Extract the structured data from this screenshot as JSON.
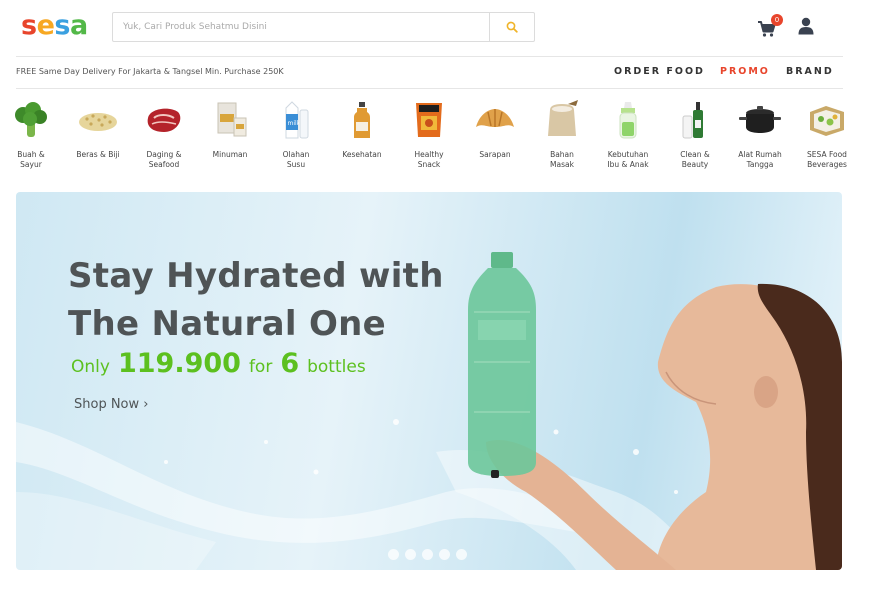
{
  "header": {
    "logo_letters": [
      "s",
      "e",
      "s",
      "a"
    ],
    "logo_colors": [
      "#e8452c",
      "#f7a823",
      "#3aa0e0",
      "#53b848"
    ],
    "search_placeholder": "Yuk, Cari Produk Sehatmu Disini",
    "cart_count": "0"
  },
  "subheader": {
    "delivery_text": "FREE Same Day Delivery For Jakarta & Tangsel Min. Purchase 250K",
    "nav": [
      "ORDER FOOD",
      "PROMO",
      "BRAND"
    ]
  },
  "categories": [
    {
      "label": "Buah &\nSayur",
      "icon": "broccoli-icon"
    },
    {
      "label": "Beras & Biji",
      "icon": "grains-icon"
    },
    {
      "label": "Daging &\nSeafood",
      "icon": "meat-icon"
    },
    {
      "label": "Minuman",
      "icon": "drink-box-icon"
    },
    {
      "label": "Olahan\nSusu",
      "icon": "milk-carton-icon"
    },
    {
      "label": "Kesehatan",
      "icon": "honey-bottle-icon"
    },
    {
      "label": "Healthy\nSnack",
      "icon": "snack-bag-icon"
    },
    {
      "label": "Sarapan",
      "icon": "croissant-icon"
    },
    {
      "label": "Bahan\nMasak",
      "icon": "flour-sack-icon"
    },
    {
      "label": "Kebutuhan\nIbu & Anak",
      "icon": "baby-bottle-icon"
    },
    {
      "label": "Clean &\nBeauty",
      "icon": "beauty-bottle-icon"
    },
    {
      "label": "Alat Rumah\nTangga",
      "icon": "cooking-pot-icon"
    },
    {
      "label": "SESA Food\nBeverages",
      "icon": "food-box-icon"
    }
  ],
  "banner": {
    "headline_line1": "Stay Hydrated with",
    "headline_line2": "The Natural One",
    "offer_only": "Only",
    "offer_price": "119.900",
    "offer_for": "for",
    "offer_qty": "6",
    "offer_unit": "bottles",
    "cta": "Shop Now ›",
    "slide_count": 5,
    "accent_color": "#5cc01f"
  }
}
